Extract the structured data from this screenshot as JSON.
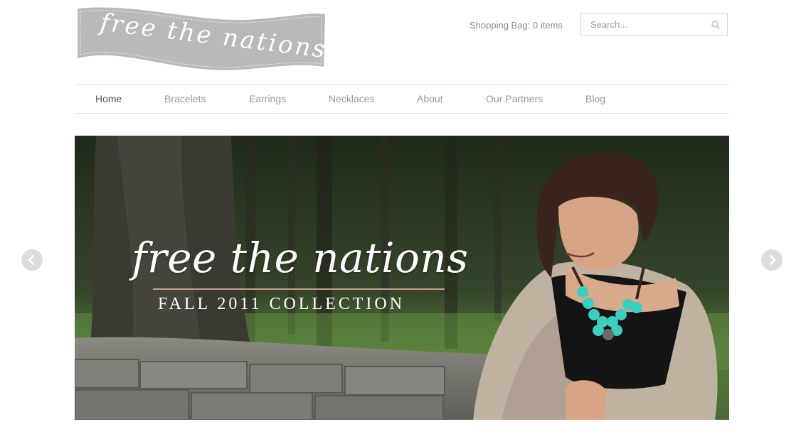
{
  "brand": {
    "logo_text": "free the nations"
  },
  "header": {
    "shopping_bag": "Shopping Bag: 0 items",
    "search_placeholder": "Search..."
  },
  "nav": {
    "items": [
      {
        "label": "Home",
        "active": true
      },
      {
        "label": "Bracelets"
      },
      {
        "label": "Earrings"
      },
      {
        "label": "Necklaces"
      },
      {
        "label": "About"
      },
      {
        "label": "Our Partners"
      },
      {
        "label": "Blog"
      }
    ]
  },
  "hero": {
    "title": "free the nations",
    "subtitle": "FALL 2011 COLLECTION"
  },
  "carousel": {
    "prev_icon": "chevron-left-icon",
    "next_icon": "chevron-right-icon"
  },
  "colors": {
    "logo_banner": "#b9b9bb",
    "nav_active": "#555555",
    "nav_text": "#9a9a9a",
    "rule_accent": "#c9a08e",
    "necklace": "#3ccfc0"
  }
}
